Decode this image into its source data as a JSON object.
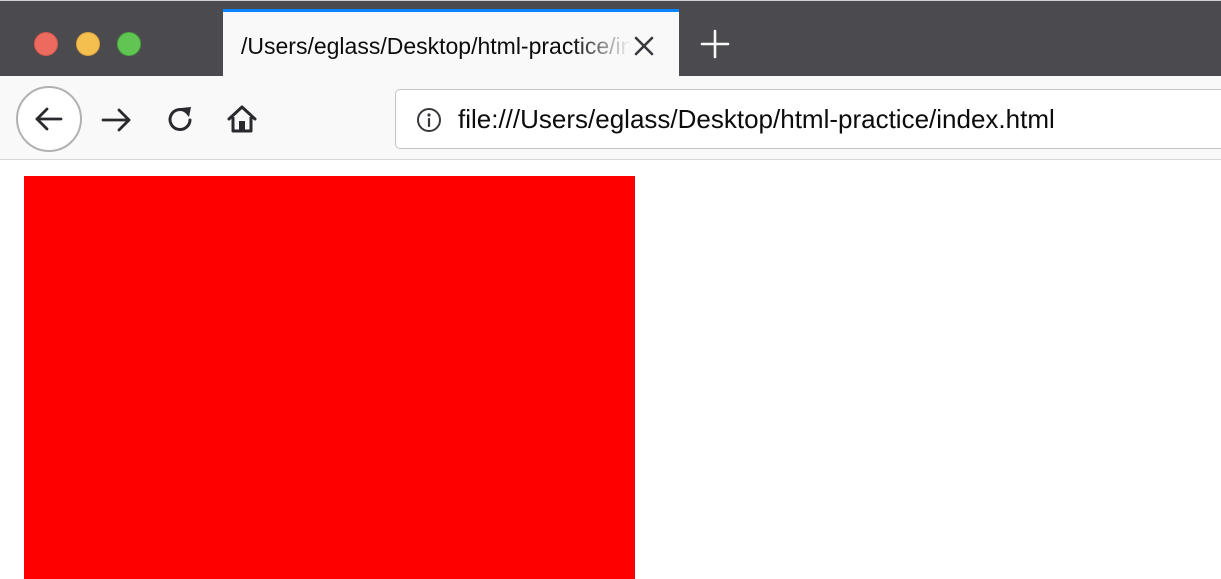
{
  "window": {
    "controls": [
      "close",
      "minimize",
      "maximize"
    ]
  },
  "tab": {
    "title": "/Users/eglass/Desktop/html-practice/index.html",
    "close_icon": "close-icon",
    "accent_color": "#0a84ff"
  },
  "new_tab": {
    "icon": "plus-icon"
  },
  "navbar": {
    "back_icon": "arrow-left-icon",
    "forward_icon": "arrow-right-icon",
    "reload_icon": "reload-icon",
    "home_icon": "home-icon"
  },
  "urlbar": {
    "info_icon": "info-icon",
    "url": "file:///Users/eglass/Desktop/html-practice/index.html"
  },
  "page": {
    "box_color": "#ff0000"
  }
}
